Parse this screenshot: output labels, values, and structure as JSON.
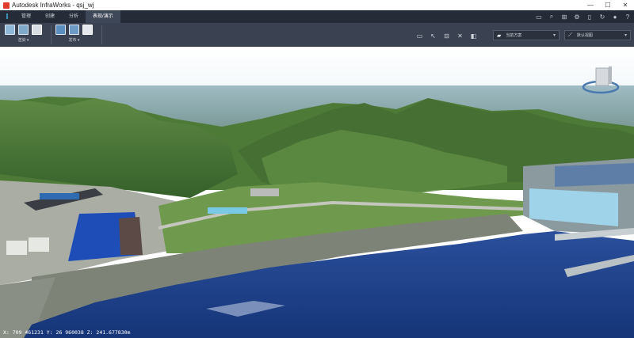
{
  "window": {
    "title": "Autodesk InfraWorks - qsj_wj",
    "controls": [
      "—",
      "☐",
      "✕"
    ]
  },
  "menubar": {
    "logo": "I",
    "tabs": [
      {
        "label": "管理",
        "active": false
      },
      {
        "label": "创建",
        "active": false
      },
      {
        "label": "分析",
        "active": false
      },
      {
        "label": "表现/演示",
        "active": true
      }
    ],
    "right_icons": [
      "layers-icon",
      "search-icon",
      "grid-icon",
      "gear-icon",
      "doc-icon",
      "sync-icon",
      "chat-icon",
      "help-icon"
    ]
  },
  "ribbon": {
    "groups": [
      {
        "label": "渲染 ▾"
      },
      {
        "label": "发布 ▾"
      }
    ],
    "tools": [
      "screen-icon",
      "select-icon",
      "measure-icon",
      "transform-icon",
      "panel-icon"
    ],
    "dropdown_left": {
      "value": "当前方案"
    },
    "dropdown_right": {
      "value": "默认视图"
    }
  },
  "colors": {
    "menubar_bg": "#262c37",
    "ribbon_bg": "#3a4150",
    "accent": "#46b4e6",
    "water": "#1d3f8c",
    "vegetation": "#4f7a3a"
  },
  "viewport": {
    "coords": "X: 709 461231 Y: 26 960038 Z: 241.677830m"
  }
}
